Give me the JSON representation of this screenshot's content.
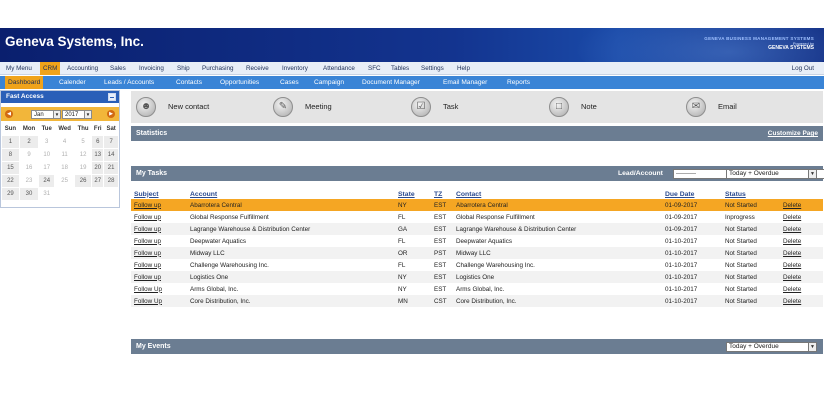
{
  "app": {
    "title": "Geneva Systems, Inc."
  },
  "branding": {
    "line1": "GENEVA BUSINESS MANAGEMENT SYSTEMS",
    "line2": "Powered by",
    "line3": "GENEVA SYSTEMS"
  },
  "menu": {
    "items": [
      "My Menu",
      "CRM",
      "Accounting",
      "Sales",
      "Invoicing",
      "Ship",
      "Purchasing",
      "Receive",
      "Inventory",
      "Attendance",
      "SFC",
      "Tables",
      "Settings",
      "Help"
    ],
    "active": "CRM",
    "logout": "Log Out"
  },
  "submenu": {
    "items": [
      "Dashboard",
      "Calender",
      "Leads / Accounts",
      "Contacts",
      "Opportunities",
      "Cases",
      "Campaign",
      "Document Manager",
      "Email Manager",
      "Reports"
    ],
    "active": "Dashboard"
  },
  "sidebar": {
    "title": "Fast Access",
    "calendar": {
      "month": "Jan",
      "year": "2017",
      "weekdays": [
        "Sun",
        "Mon",
        "Tue",
        "Wed",
        "Thu",
        "Fri",
        "Sat"
      ],
      "weeks": [
        [
          "1",
          "2",
          "3",
          "4",
          "5",
          "6",
          "7"
        ],
        [
          "8",
          "9",
          "10",
          "11",
          "12",
          "13",
          "14"
        ],
        [
          "15",
          "16",
          "17",
          "18",
          "19",
          "20",
          "21"
        ],
        [
          "22",
          "23",
          "24",
          "25",
          "26",
          "27",
          "28"
        ],
        [
          "29",
          "30",
          "31",
          "",
          "",
          "",
          ""
        ]
      ]
    }
  },
  "quick_actions": [
    {
      "label": "New contact",
      "icon": "contact-icon"
    },
    {
      "label": "Meeting",
      "icon": "meeting-icon"
    },
    {
      "label": "Task",
      "icon": "task-icon"
    },
    {
      "label": "Note",
      "icon": "note-icon"
    },
    {
      "label": "Email",
      "icon": "email-icon"
    }
  ],
  "statistics": {
    "title": "Statistics",
    "customize": "Customize Page"
  },
  "tasks": {
    "title": "My Tasks",
    "lead_label": "Lead/Account",
    "lead_value": "----------",
    "view_value": "Today + Overdue",
    "columns": [
      "Subject",
      "Account",
      "State",
      "TZ",
      "Contact",
      "Due Date",
      "Status",
      ""
    ],
    "rows": [
      [
        "Follow up",
        "Abarrotera Central",
        "NY",
        "EST",
        "Abarrotera Central",
        "01-09-2017",
        "Not Started",
        "Delete"
      ],
      [
        "Follow up",
        "Global Response Fulfillment",
        "FL",
        "EST",
        "Global Response Fulfillment",
        "01-09-2017",
        "Inprogress",
        "Delete"
      ],
      [
        "Follow up",
        "Lagrange Warehouse & Distribution Center",
        "GA",
        "EST",
        "Lagrange Warehouse & Distribution Center",
        "01-09-2017",
        "Not Started",
        "Delete"
      ],
      [
        "Follow up",
        "Deepwater Aquatics",
        "FL",
        "EST",
        "Deepwater Aquatics",
        "01-10-2017",
        "Not Started",
        "Delete"
      ],
      [
        "Follow up",
        "Midway LLC",
        "OR",
        "PST",
        "Midway LLC",
        "01-10-2017",
        "Not Started",
        "Delete"
      ],
      [
        "Follow up",
        "Challenge Warehousing Inc.",
        "FL",
        "EST",
        "Challenge Warehousing Inc.",
        "01-10-2017",
        "Not Started",
        "Delete"
      ],
      [
        "Follow up",
        "Logistics One",
        "NY",
        "EST",
        "Logistics One",
        "01-10-2017",
        "Not Started",
        "Delete"
      ],
      [
        "Follow Up",
        "Arms Global, Inc.",
        "NY",
        "EST",
        "Arms Global, Inc.",
        "01-10-2017",
        "Not Started",
        "Delete"
      ],
      [
        "Follow Up",
        "Core Distribution, Inc.",
        "MN",
        "CST",
        "Core Distribution, Inc.",
        "01-10-2017",
        "Not Started",
        "Delete"
      ]
    ]
  },
  "events": {
    "title": "My Events",
    "view_value": "Today + Overdue"
  },
  "colors": {
    "accent": "#f0a31a",
    "header": "#13348f",
    "bar": "#6b7d92",
    "submenu": "#3a84d6"
  }
}
